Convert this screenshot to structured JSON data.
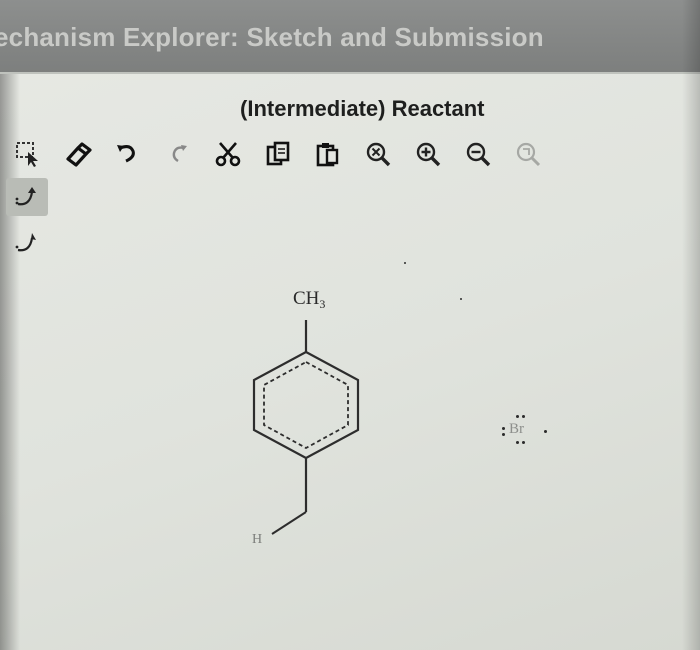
{
  "window": {
    "title": "echanism Explorer: Sketch and Submission"
  },
  "panel": {
    "title": "(Intermediate) Reactant"
  },
  "toolbar": {
    "tools": [
      {
        "name": "select-tool",
        "icon": "marquee-select-icon"
      },
      {
        "name": "erase-tool",
        "icon": "eraser-icon"
      },
      {
        "name": "undo-tool",
        "icon": "undo-icon"
      },
      {
        "name": "redo-tool",
        "icon": "redo-icon"
      },
      {
        "name": "cut-tool",
        "icon": "scissors-icon"
      },
      {
        "name": "copy-tool",
        "icon": "copy-icon"
      },
      {
        "name": "paste-tool",
        "icon": "paste-icon"
      },
      {
        "name": "zoom-clear-tool",
        "icon": "zoom-clear-icon"
      },
      {
        "name": "zoom-in-tool",
        "icon": "zoom-in-icon"
      },
      {
        "name": "zoom-out-tool",
        "icon": "zoom-out-icon"
      },
      {
        "name": "zoom-fit-tool",
        "icon": "zoom-fit-icon"
      }
    ]
  },
  "sidebar": {
    "tools": [
      {
        "name": "curved-arrow-electron-pair",
        "icon": "curved-arrow-icon",
        "active": true
      },
      {
        "name": "curved-arrow-single-electron",
        "icon": "half-arrow-icon",
        "active": false
      }
    ]
  },
  "molecule": {
    "methyl_label": "CH",
    "methyl_subscript": "3",
    "hydrogen_label": "H",
    "bromine_label": "Br"
  },
  "colors": {
    "titlebar": "#7d7f7e",
    "panel": "#e2e5df",
    "ink": "#2b2b2b"
  }
}
